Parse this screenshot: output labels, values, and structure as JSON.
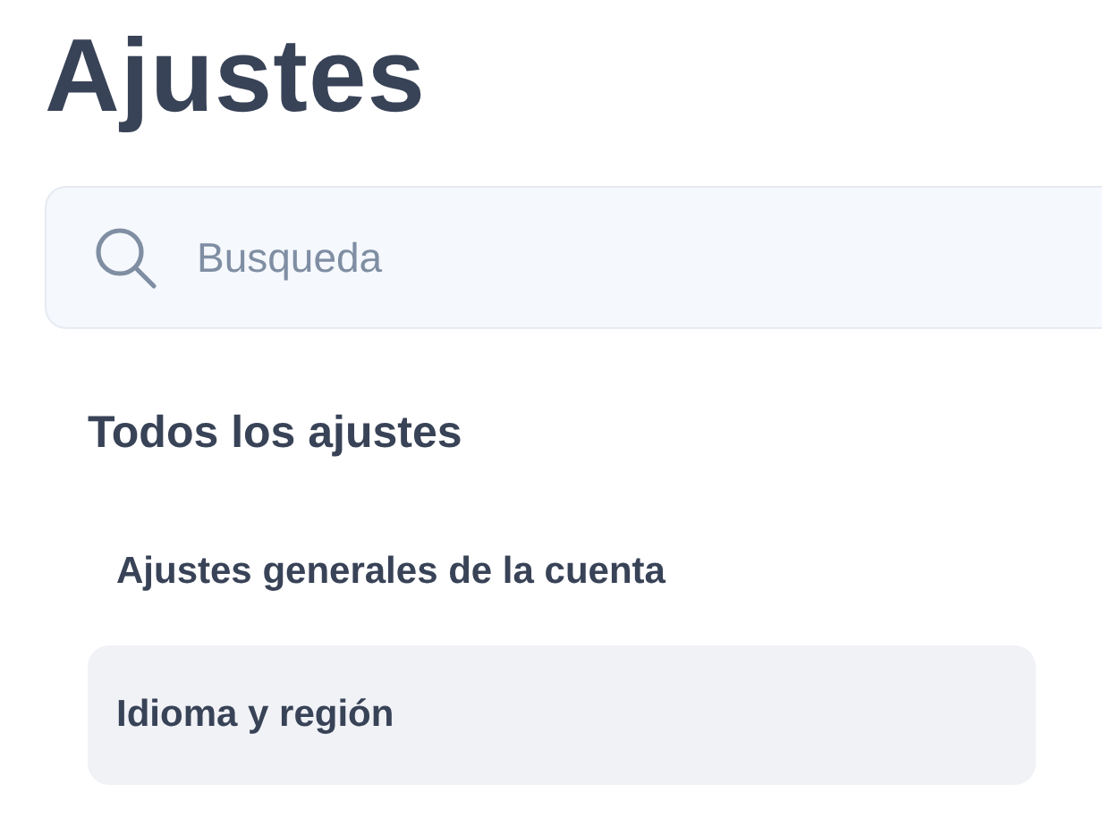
{
  "title": "Ajustes",
  "search": {
    "placeholder": "Busqueda"
  },
  "section": {
    "heading": "Todos los ajustes",
    "items": [
      {
        "label": "Ajustes generales de la cuenta",
        "selected": false
      },
      {
        "label": "Idioma y región",
        "selected": true
      }
    ]
  }
}
